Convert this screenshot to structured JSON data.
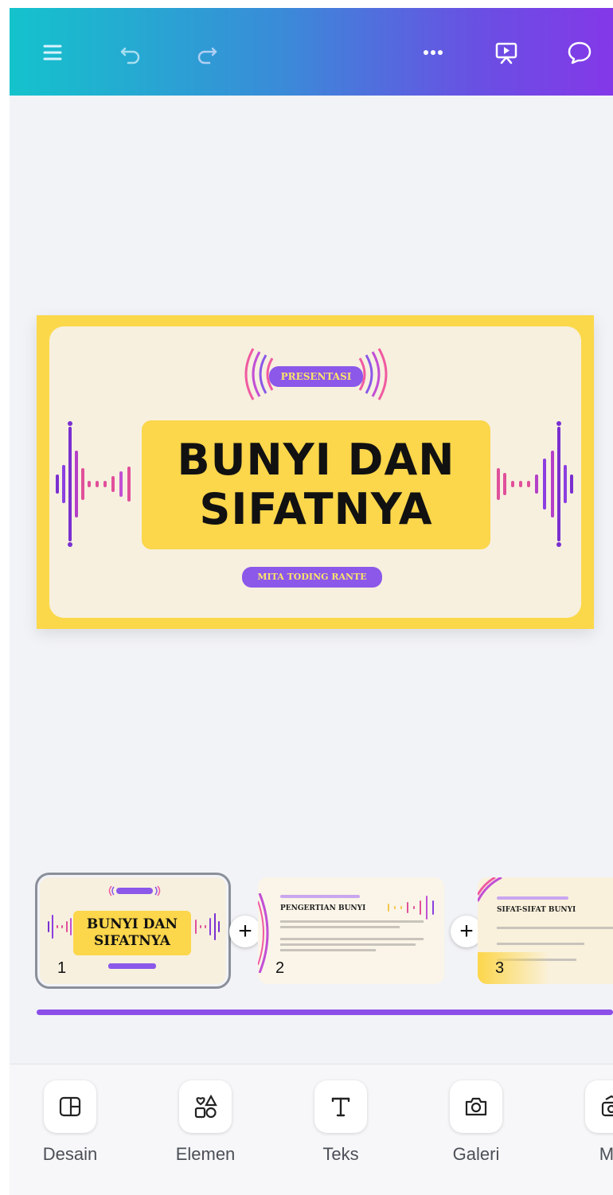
{
  "header": {
    "icons": [
      "menu-icon",
      "undo-icon",
      "redo-icon",
      "more-icon",
      "present-icon",
      "comment-icon"
    ]
  },
  "slide": {
    "badge": "PRESENTASI",
    "title_line1": "BUNYI DAN",
    "title_line2": "SIFATNYA",
    "author": "MITA TODING RANTE"
  },
  "thumbnails": [
    {
      "number": "1",
      "title_line1": "BUNYI DAN",
      "title_line2": "SIFATNYA"
    },
    {
      "number": "2",
      "heading": "PENGERTIAN BUNYI"
    },
    {
      "number": "3",
      "heading": "SIFAT-SIFAT BUNYI"
    }
  ],
  "add_page_label": "+",
  "toolbar": {
    "items": [
      {
        "label": "Desain",
        "icon": "layout-icon"
      },
      {
        "label": "Elemen",
        "icon": "shapes-icon"
      },
      {
        "label": "Teks",
        "icon": "text-icon"
      },
      {
        "label": "Galeri",
        "icon": "camera-icon"
      },
      {
        "label": "Me",
        "icon": "media-icon"
      }
    ]
  },
  "colors": {
    "accent_purple": "#8b58e9",
    "slide_yellow": "#fbd84a",
    "slide_cream": "#f7f0df"
  }
}
